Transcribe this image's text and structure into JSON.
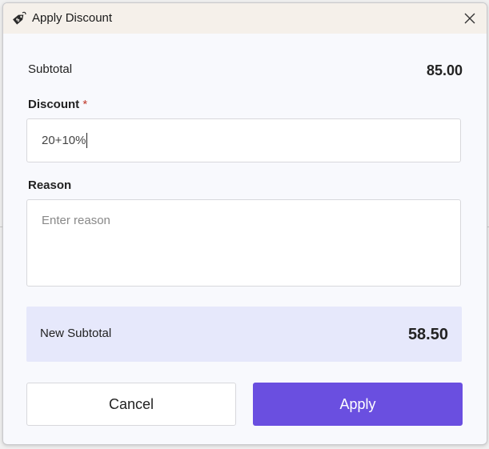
{
  "window": {
    "title": "Apply Discount",
    "icon": "price-tag-icon",
    "close_icon": "close-icon"
  },
  "subtotal": {
    "label": "Subtotal",
    "value": "85.00"
  },
  "discount": {
    "label": "Discount",
    "required_marker": "*",
    "value": "20+10%"
  },
  "reason": {
    "label": "Reason",
    "placeholder": "Enter reason",
    "value": ""
  },
  "new_subtotal": {
    "label": "New Subtotal",
    "value": "58.50"
  },
  "buttons": {
    "cancel_label": "Cancel",
    "apply_label": "Apply"
  },
  "colors": {
    "accent": "#6a4fe0",
    "summary_bg": "#e6e8fb",
    "titlebar_bg": "#f5f0ea",
    "required": "#c0392b"
  }
}
